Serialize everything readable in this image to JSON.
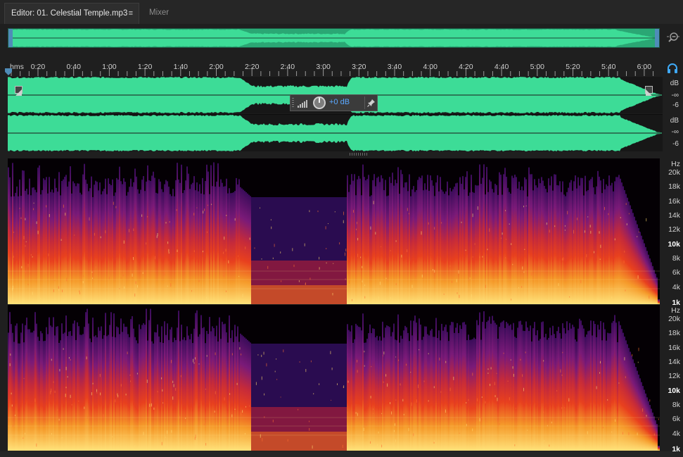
{
  "tabs": {
    "editor_label": "Editor: 01. Celestial Temple.mp3",
    "editor_menu_icon": "≡",
    "mixer_label": "Mixer"
  },
  "ruler": {
    "unit_label": "hms",
    "ticks": [
      "0:20",
      "0:40",
      "1:00",
      "1:20",
      "1:40",
      "2:00",
      "2:20",
      "2:40",
      "3:00",
      "3:20",
      "3:40",
      "4:00",
      "4:20",
      "4:40",
      "5:00",
      "5:20",
      "5:40",
      "6:00"
    ]
  },
  "hud": {
    "volume_label": "+0 dB",
    "icons": [
      "level-meter-icon",
      "volume-knob-icon",
      "pin-icon"
    ]
  },
  "waveform_scale": {
    "unit": "dB",
    "left_channel": [
      "dB",
      "-∞",
      "-6"
    ],
    "right_channel": [
      "dB",
      "-∞",
      "-6"
    ]
  },
  "spectral_scale": {
    "unit": "Hz",
    "labels": [
      "20k",
      "18k",
      "16k",
      "14k",
      "12k",
      "10k",
      "8k",
      "6k",
      "4k",
      "1k"
    ],
    "bold_labels": [
      "10k",
      "1k"
    ]
  },
  "icons": [
    "zoom-out-icon",
    "headphones-icon",
    "playhead-marker-icon",
    "fade-in-icon",
    "fade-out-icon"
  ],
  "colors": {
    "waveform": "#3ddc97",
    "accent": "#4f8cb8",
    "volume_text": "#5aa8ff",
    "spectral_low": "#ffd060",
    "spectral_mid": "#e0301c",
    "spectral_high": "#6a1880"
  }
}
